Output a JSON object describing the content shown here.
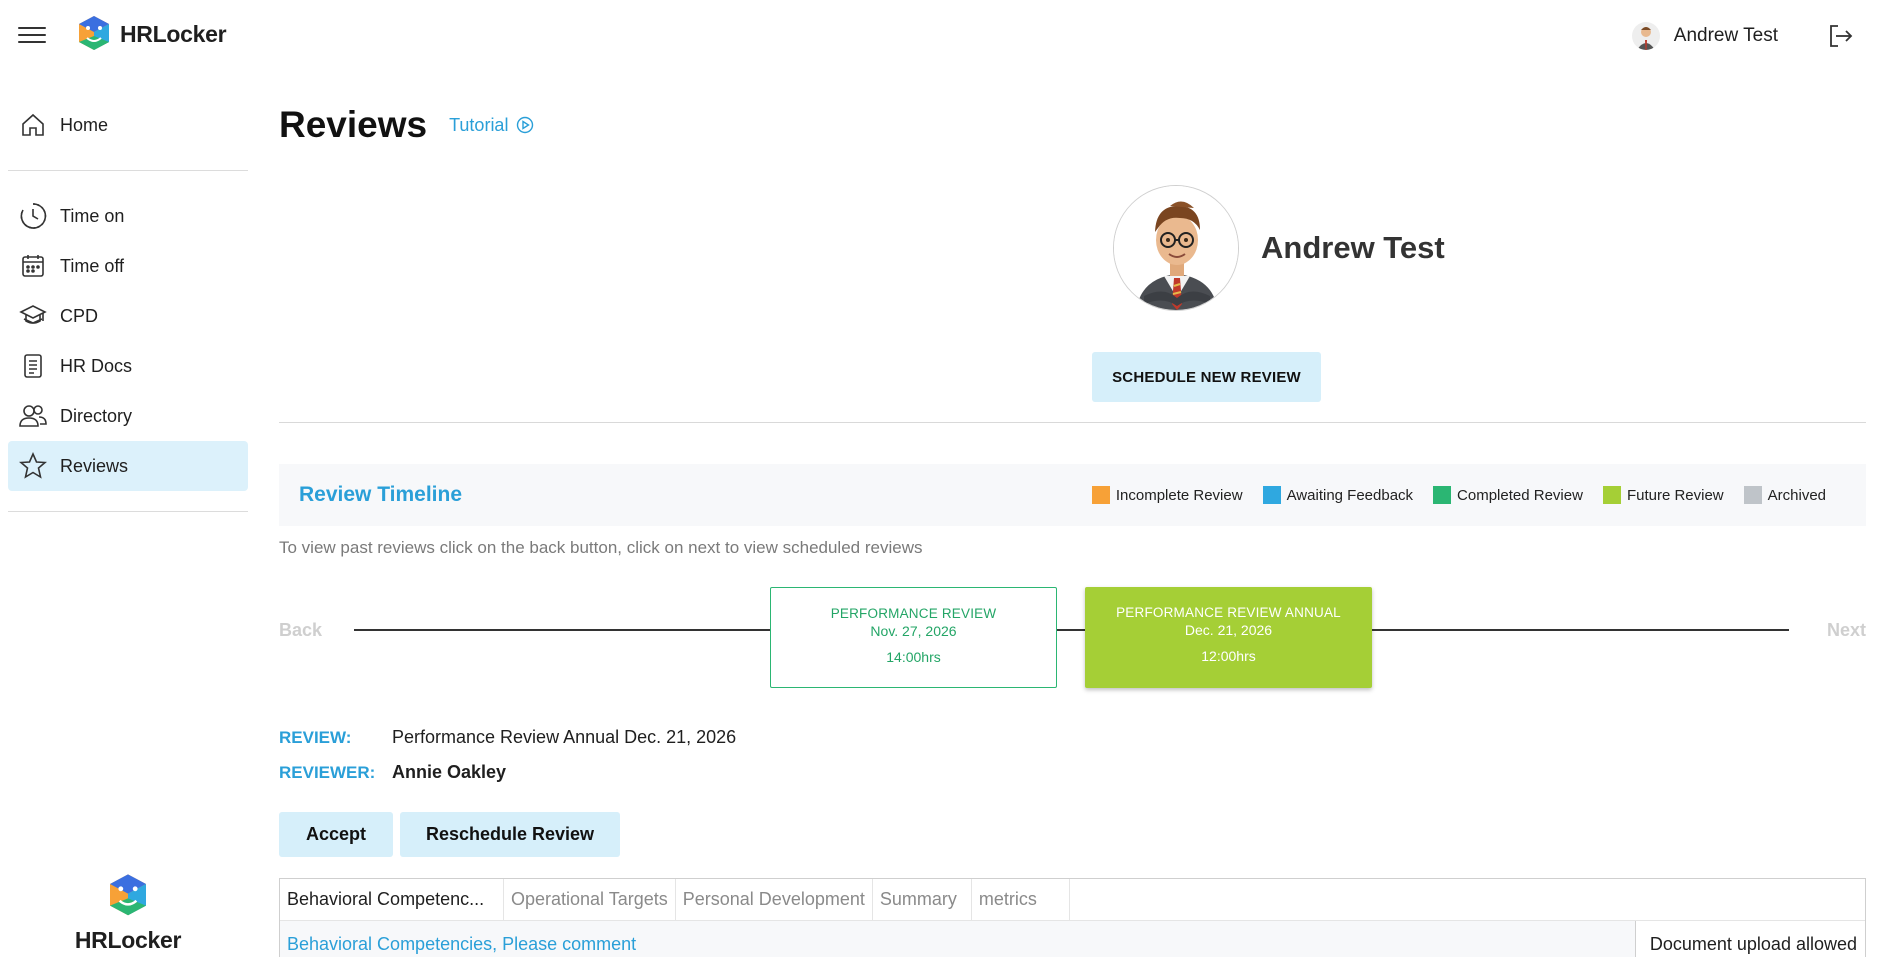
{
  "app": {
    "brand": "HRLocker",
    "user_name": "Andrew Test"
  },
  "sidebar": {
    "items": [
      {
        "label": "Home",
        "icon": "home-icon"
      },
      {
        "label": "Time on",
        "icon": "clock-icon"
      },
      {
        "label": "Time off",
        "icon": "calendar-icon"
      },
      {
        "label": "CPD",
        "icon": "graduation-cap-icon"
      },
      {
        "label": "HR Docs",
        "icon": "document-icon"
      },
      {
        "label": "Directory",
        "icon": "people-icon"
      },
      {
        "label": "Reviews",
        "icon": "star-icon",
        "active": true
      }
    ],
    "footer_brand": "HRLocker"
  },
  "page": {
    "title": "Reviews",
    "tutorial_label": "Tutorial",
    "employee_name": "Andrew Test",
    "schedule_button": "SCHEDULE NEW REVIEW"
  },
  "timeline": {
    "title": "Review Timeline",
    "legend": [
      {
        "label": "Incomplete Review",
        "color": "#f7a137"
      },
      {
        "label": "Awaiting Feedback",
        "color": "#2fa8e0"
      },
      {
        "label": "Completed Review",
        "color": "#2bb673"
      },
      {
        "label": "Future Review",
        "color": "#a5cf36"
      },
      {
        "label": "Archived",
        "color": "#bfc4c9"
      }
    ],
    "hint": "To view past reviews click on the back button, click on next to view scheduled reviews",
    "back_label": "Back",
    "next_label": "Next",
    "cards": [
      {
        "title": "PERFORMANCE REVIEW",
        "date": "Nov. 27, 2026",
        "time": "14:00hrs"
      },
      {
        "title": "PERFORMANCE REVIEW ANNUAL",
        "date": "Dec. 21, 2026",
        "time": "12:00hrs"
      }
    ]
  },
  "review": {
    "review_label": "REVIEW:",
    "review_value": "Performance Review Annual Dec. 21, 2026",
    "reviewer_label": "REVIEWER:",
    "reviewer_value": "Annie Oakley",
    "accept_button": "Accept",
    "reschedule_button": "Reschedule Review"
  },
  "tabs": {
    "items": [
      "Behavioral Competenc...",
      "Operational Targets",
      "Personal Development",
      "Summary",
      "metrics"
    ],
    "content_link": "Behavioral Competencies, Please comment",
    "upload_note": "Document upload allowed"
  }
}
